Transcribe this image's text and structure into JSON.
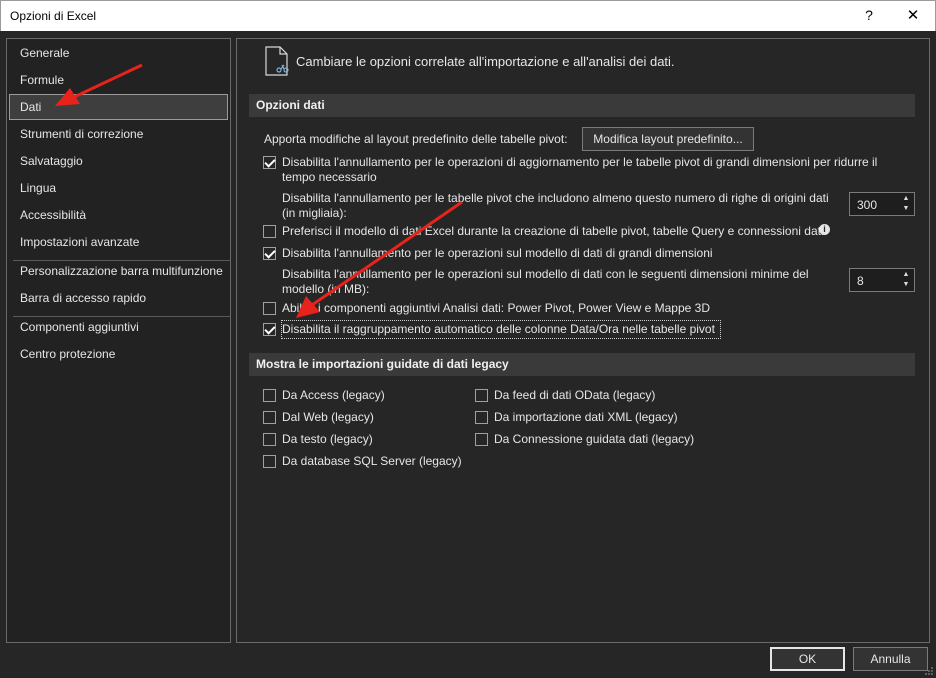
{
  "window": {
    "title": "Opzioni di Excel",
    "help_label": "?",
    "close_label": "✕"
  },
  "sidebar": {
    "items": [
      {
        "label": "Generale"
      },
      {
        "label": "Formule"
      },
      {
        "label": "Dati"
      },
      {
        "label": "Strumenti di correzione"
      },
      {
        "label": "Salvataggio"
      },
      {
        "label": "Lingua"
      },
      {
        "label": "Accessibilità"
      },
      {
        "label": "Impostazioni avanzate"
      },
      {
        "label": "Personalizzazione barra multifunzione"
      },
      {
        "label": "Barra di accesso rapido"
      },
      {
        "label": "Componenti aggiuntivi"
      },
      {
        "label": "Centro protezione"
      }
    ],
    "selected": "Dati"
  },
  "header": {
    "text": "Cambiare le opzioni correlate all'importazione e all'analisi dei dati."
  },
  "data_options": {
    "title": "Opzioni dati",
    "pivot_layout_label": "Apporta modifiche al layout predefinito delle tabelle pivot:",
    "pivot_layout_button": "Modifica layout predefinito...",
    "disable_undo_pivot_line1": "Disabilita l'annullamento per le operazioni di aggiornamento per le tabelle pivot di grandi dimensioni per ridurre il",
    "disable_undo_pivot_line2": "tempo necessario",
    "disable_undo_pivot_checked": true,
    "rows_threshold_line1": "Disabilita l'annullamento per le tabelle pivot che includono almeno questo numero di righe di origini dati",
    "rows_threshold_line2": "(in migliaia):",
    "rows_threshold_value": "300",
    "prefer_data_model_label": "Preferisci il modello di dati Excel durante la creazione di tabelle pivot, tabelle Query e connessioni dati",
    "prefer_data_model_checked": false,
    "disable_undo_model_label": "Disabilita l'annullamento per le operazioni sul modello di dati di grandi dimensioni",
    "disable_undo_model_checked": true,
    "model_size_line1": "Disabilita l'annullamento per le operazioni sul modello di dati con le seguenti dimensioni minime del",
    "model_size_line2": "modello (in MB):",
    "model_size_value": "8",
    "enable_addins_label": "Abilita i componenti aggiuntivi Analisi dati: Power Pivot, Power View e Mappe 3D",
    "enable_addins_checked": false,
    "disable_grouping_label": "Disabilita il raggruppamento automatico delle colonne Data/Ora nelle tabelle pivot",
    "disable_grouping_checked": true
  },
  "legacy": {
    "title": "Mostra le importazioni guidate di dati legacy",
    "col1": [
      {
        "label": "Da Access (legacy)",
        "checked": false
      },
      {
        "label": "Dal Web (legacy)",
        "checked": false
      },
      {
        "label": "Da testo (legacy)",
        "checked": false
      },
      {
        "label": "Da database SQL Server (legacy)",
        "checked": false
      }
    ],
    "col2": [
      {
        "label": "Da feed di dati OData (legacy)",
        "checked": false
      },
      {
        "label": "Da importazione dati XML (legacy)",
        "checked": false
      },
      {
        "label": "Da Connessione guidata dati (legacy)",
        "checked": false
      }
    ]
  },
  "footer": {
    "ok_label": "OK",
    "cancel_label": "Annulla"
  },
  "colors": {
    "background": "#262626",
    "section_bar": "#3a3a3a",
    "annotation_arrow": "#e8231c"
  }
}
